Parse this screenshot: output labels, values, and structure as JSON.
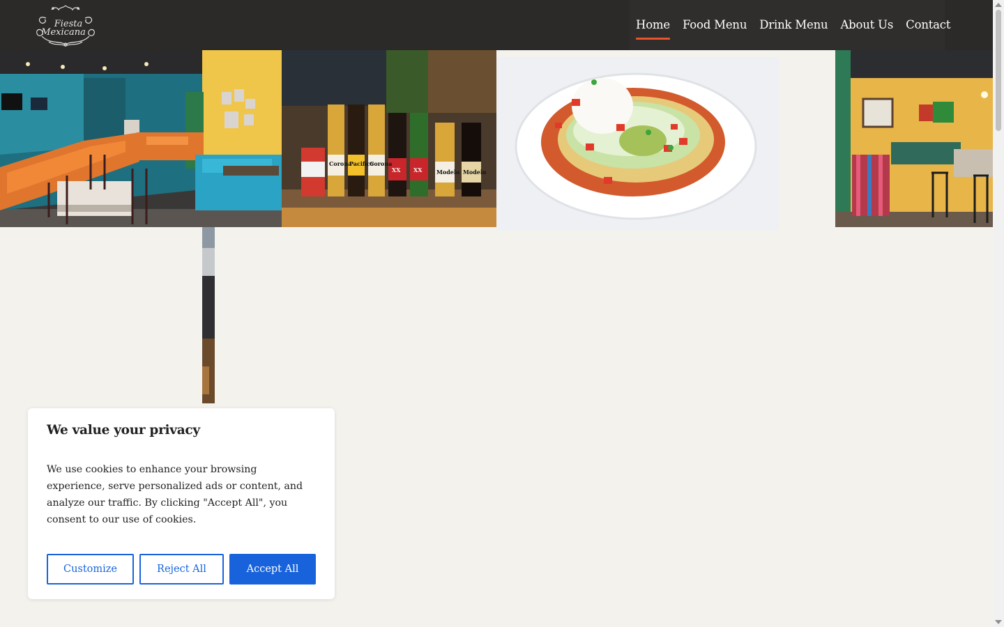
{
  "header": {
    "logo_text_line1": "Fiesta",
    "logo_text_line2": "Mexicana"
  },
  "nav": {
    "items": [
      {
        "label": "Home",
        "active": true
      },
      {
        "label": "Food Menu"
      },
      {
        "label": "Drink Menu"
      },
      {
        "label": "About Us"
      },
      {
        "label": "Contact"
      }
    ]
  },
  "gallery": {
    "photos": [
      {
        "subject": "restaurant dining room with orange and teal booths"
      },
      {
        "subject": "Mexican beer bottles on bar counter"
      },
      {
        "subject": "burrito plate with lettuce, tomato, sour cream and guacamole"
      },
      {
        "subject": "dining room with teal and yellow walls"
      },
      {
        "subject": "partial restaurant photo"
      }
    ],
    "beer_labels": [
      "Corona",
      "Pacifico",
      "Corona",
      "XX",
      "XX",
      "Modelo",
      "Modelo"
    ]
  },
  "cookie_banner": {
    "title": "We value your privacy",
    "body": "We use cookies to enhance your browsing experience, serve personalized ads or content, and analyze our traffic. By clicking \"Accept All\", you consent to our use of cookies.",
    "buttons": {
      "customize": "Customize",
      "reject": "Reject All",
      "accept": "Accept All"
    },
    "accent_color": "#1863dc"
  },
  "theme": {
    "header_bg": "#2b2a29",
    "nav_active_underline": "#e8542b",
    "page_bg": "#f4f2ed"
  }
}
